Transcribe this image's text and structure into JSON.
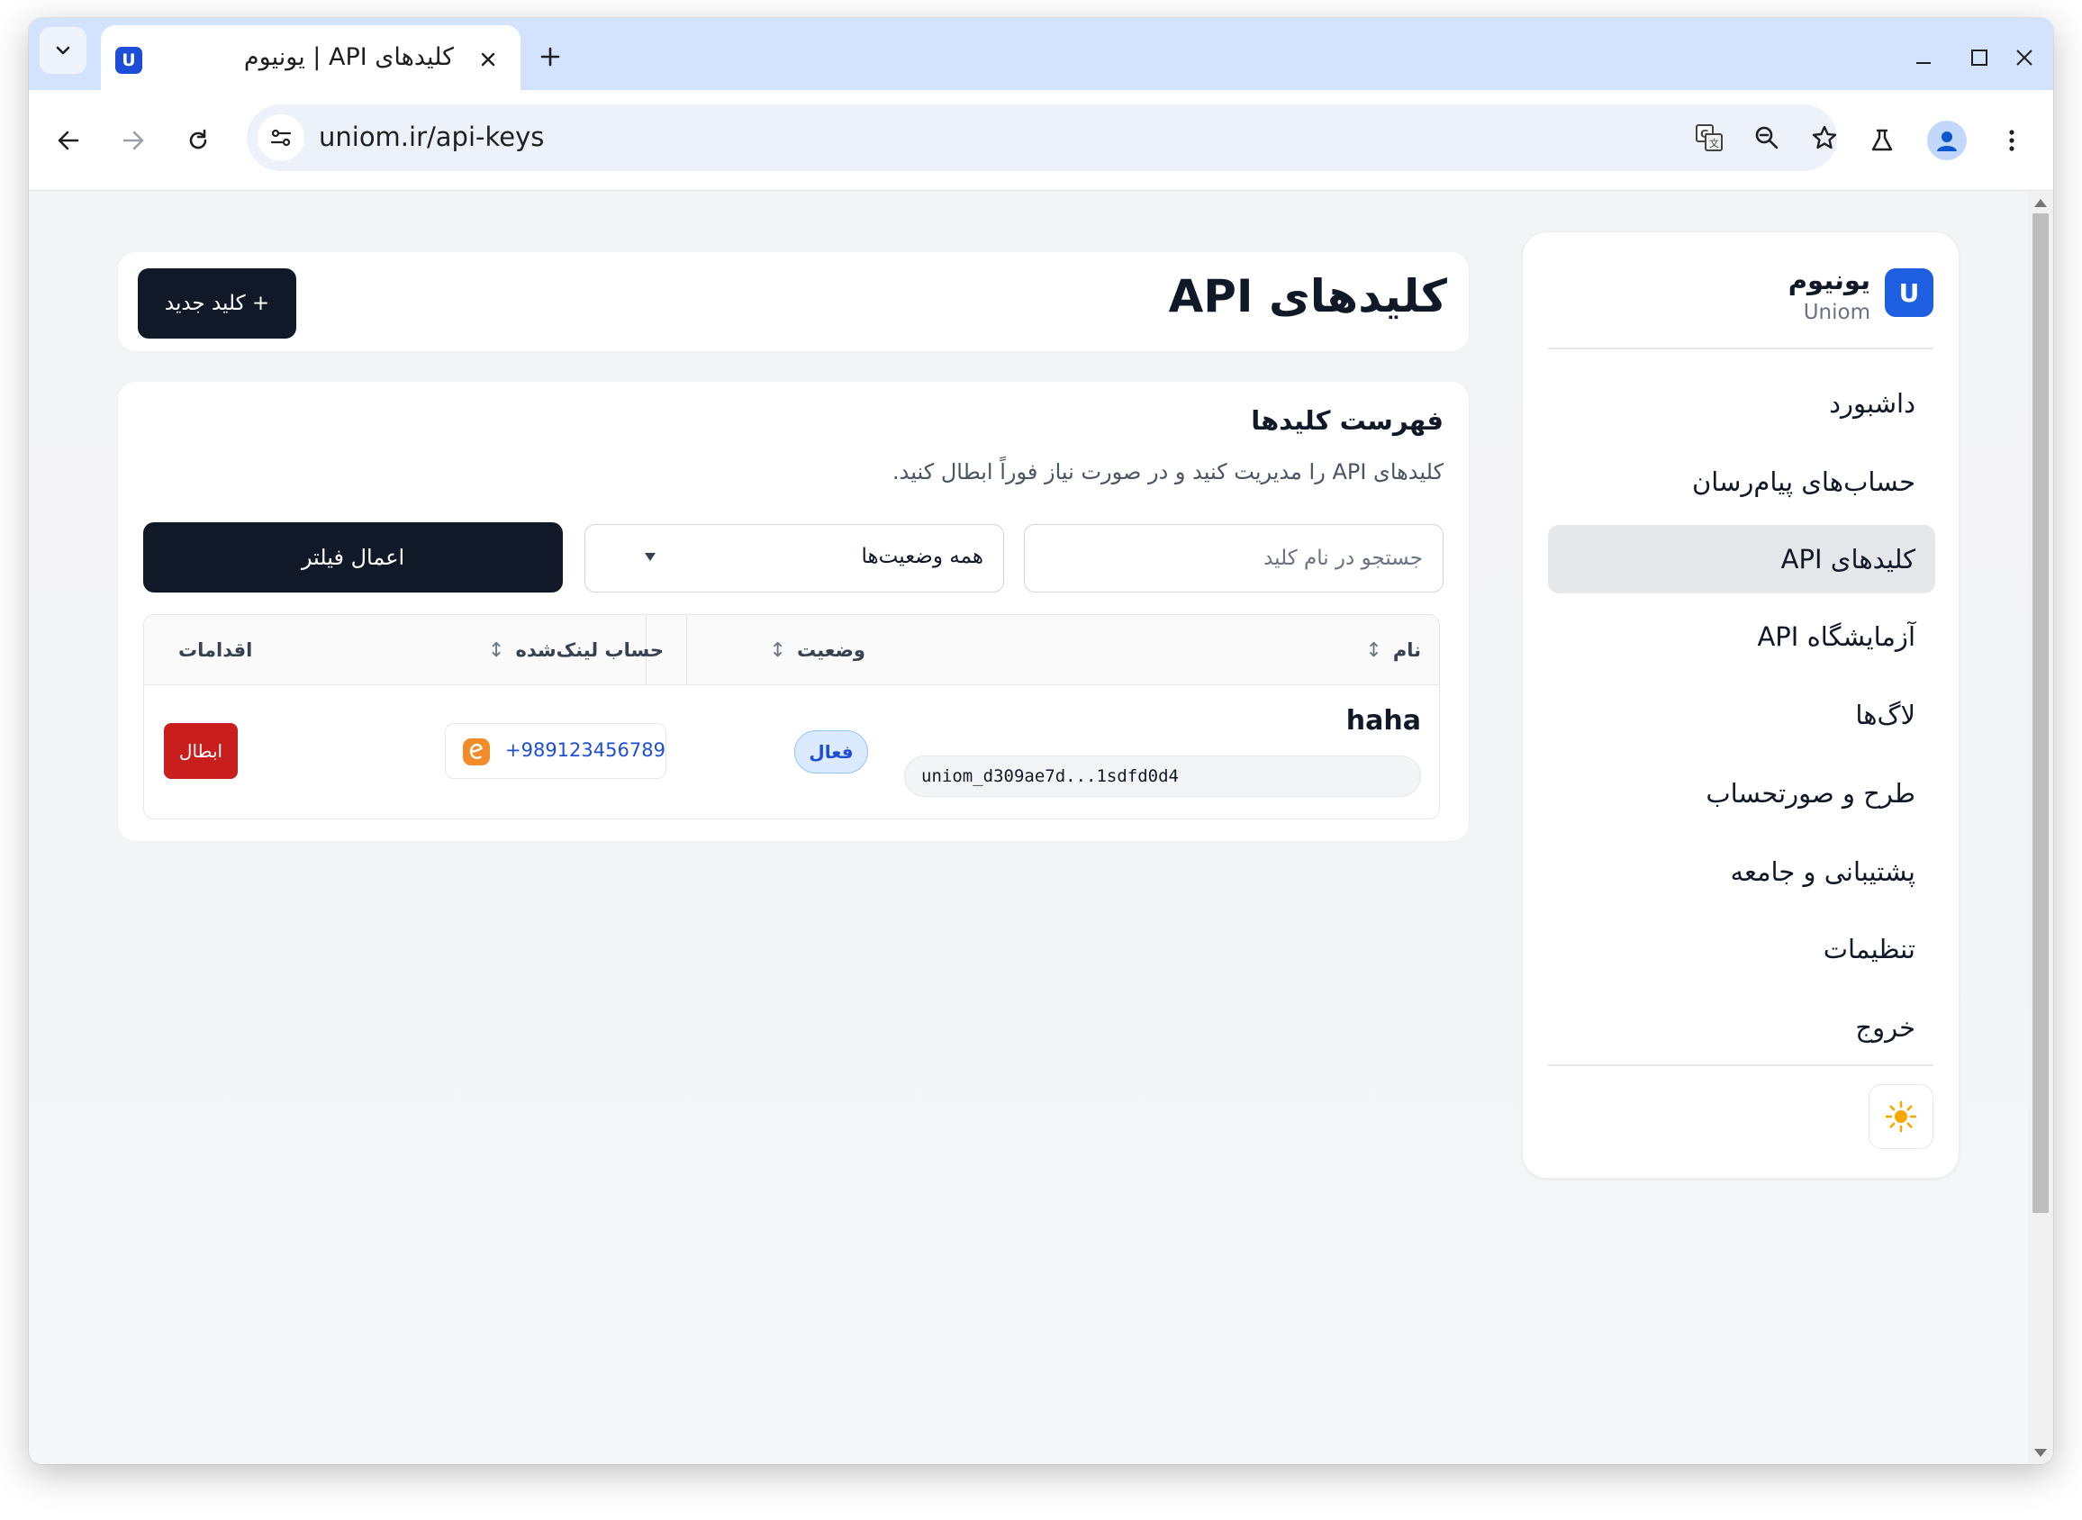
{
  "browser": {
    "tab_title": "کلیدهای API | یونیوم",
    "tab_favicon_letter": "U",
    "url": "uniom.ir/api-keys"
  },
  "sidebar": {
    "logo_letter": "U",
    "brand_name": "یونیوم",
    "brand_sub": "Uniom",
    "items": [
      {
        "label": "داشبورد",
        "active": false
      },
      {
        "label": "حساب‌های پیام‌رسان",
        "active": false
      },
      {
        "label": "کلیدهای API",
        "active": true
      },
      {
        "label": "آزمایشگاه API",
        "active": false
      },
      {
        "label": "لاگ‌ها",
        "active": false
      },
      {
        "label": "طرح و صورتحساب",
        "active": false
      },
      {
        "label": "پشتیبانی و جامعه",
        "active": false
      },
      {
        "label": "تنظیمات",
        "active": false
      },
      {
        "label": "خروج",
        "active": false
      }
    ],
    "theme_icon": "sun-icon"
  },
  "header": {
    "title": "کلیدهای API",
    "new_key_label": "+ کلید جدید"
  },
  "list": {
    "title": "فهرست کلیدها",
    "description": "کلیدهای API را مدیریت کنید و در صورت نیاز فوراً ابطال کنید.",
    "search_placeholder": "جستجو در نام کلید",
    "status_filter_value": "همه وضعیت‌ها",
    "apply_filter_label": "اعمال فیلتر",
    "columns": {
      "name": "نام",
      "status": "وضعیت",
      "linked_account": "حساب لینک‌شده",
      "actions": "اقدامات"
    },
    "sort_glyph": "↕",
    "rows": [
      {
        "name": "haha",
        "token": "uniom_d309ae7d...1sdfd0d4",
        "status": "فعال",
        "linked_account": "+989123456789",
        "action_label": "ابطال"
      }
    ]
  },
  "colors": {
    "brand_blue": "#1d5fe0",
    "primary_dark": "#111827",
    "danger": "#c81e1e",
    "status_active_bg": "#dbeafe",
    "eitaa_orange": "#f28c28"
  }
}
